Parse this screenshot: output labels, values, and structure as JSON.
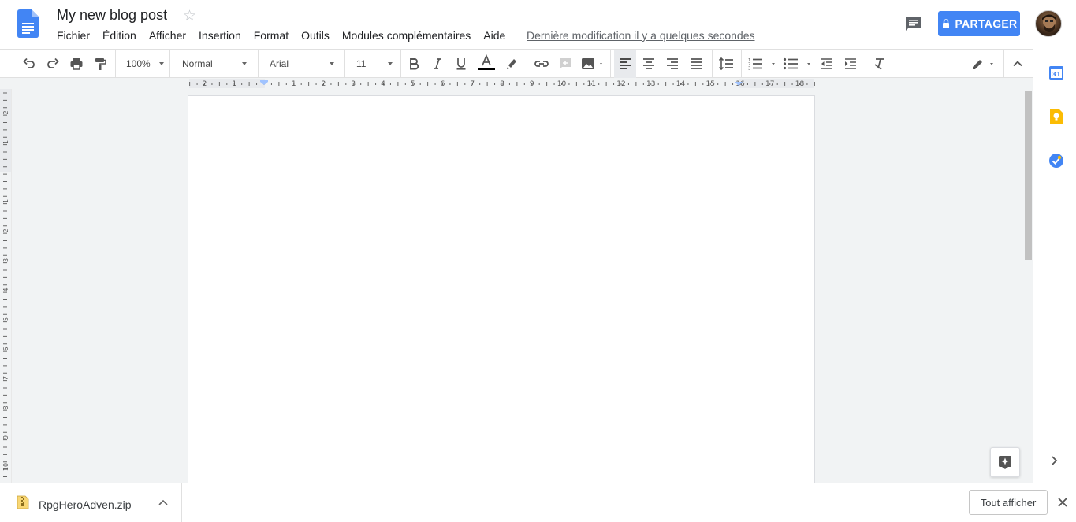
{
  "header": {
    "title": "My new blog post",
    "last_edit": "Dernière modification il y a quelques secondes",
    "share_label": "PARTAGER"
  },
  "menu": [
    "Fichier",
    "Édition",
    "Afficher",
    "Insertion",
    "Format",
    "Outils",
    "Modules complémentaires",
    "Aide"
  ],
  "toolbar": {
    "zoom": "100%",
    "style": "Normal",
    "font": "Arial",
    "font_size": "11",
    "icons": [
      "undo-icon",
      "redo-icon",
      "print-icon",
      "paint-format-icon",
      "bold-icon",
      "italic-icon",
      "underline-icon",
      "text-color-icon",
      "highlight-icon",
      "link-icon",
      "comment-add-icon",
      "image-icon",
      "align-left-icon",
      "align-center-icon",
      "align-right-icon",
      "justify-icon",
      "line-spacing-icon",
      "numbered-list-icon",
      "bulleted-list-icon",
      "indent-decrease-icon",
      "indent-increase-icon",
      "clear-format-icon",
      "edit-mode-icon",
      "collapse-icon"
    ]
  },
  "ruler": {
    "h_labels": [
      "2",
      "1",
      "1",
      "2",
      "3",
      "4",
      "5",
      "6",
      "7",
      "8",
      "9",
      "10",
      "11",
      "12",
      "13",
      "14",
      "15",
      "16",
      "17",
      "18"
    ],
    "v_labels": [
      "2",
      "1",
      "1",
      "2",
      "3",
      "4",
      "5",
      "6",
      "7",
      "8",
      "9",
      "10"
    ]
  },
  "sidepanel": {
    "icons": [
      "calendar-icon",
      "keep-icon",
      "tasks-icon"
    ],
    "calendar_day": "31"
  },
  "download_bar": {
    "file_name": "RpgHeroAdven.zip",
    "show_all": "Tout afficher"
  },
  "colors": {
    "accent": "#4285f4",
    "text_color_bar": "#000000",
    "docs_blue": "#4285f4",
    "keep_yellow": "#fbbc04"
  }
}
